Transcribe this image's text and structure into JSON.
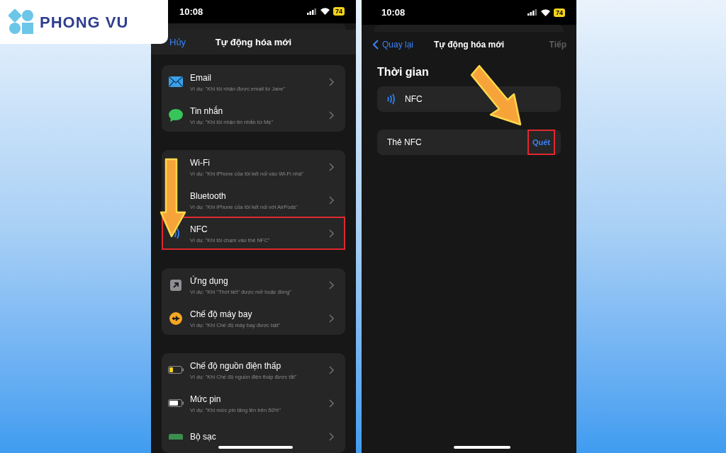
{
  "brand": {
    "name": "PHONG VU"
  },
  "screens": [
    {
      "kind": "trigger_list",
      "status_bar": {
        "time": "10:08",
        "battery": "74"
      },
      "nav": {
        "left": "Hủy",
        "title": "Tự động hóa mới"
      },
      "groups": [
        [
          {
            "title": "Email",
            "subtitle": "Ví dụ: \"Khi tôi nhận được email từ Jane\"",
            "highlighted": false
          },
          {
            "title": "Tin nhắn",
            "subtitle": "Ví dụ: \"Khi tôi nhận tin nhắn từ Mẹ\"",
            "highlighted": false
          }
        ],
        [
          {
            "title": "Wi-Fi",
            "subtitle": "Ví dụ: \"Khi iPhone của tôi kết nối vào Wi-Fi nhà\"",
            "highlighted": false
          },
          {
            "title": "Bluetooth",
            "subtitle": "Ví dụ: \"Khi iPhone của tôi kết nối với AirPods\"",
            "highlighted": false
          },
          {
            "title": "NFC",
            "subtitle": "Ví dụ: \"Khi tôi chạm vào thẻ NFC\"",
            "highlighted": true
          }
        ],
        [
          {
            "title": "Ứng dụng",
            "subtitle": "Ví dụ: \"Khi \"Thời tiết\" được mở hoặc đóng\"",
            "highlighted": false
          },
          {
            "title": "Chế độ máy bay",
            "subtitle": "Ví dụ: \"Khi Chế độ máy bay được bật\"",
            "highlighted": false
          }
        ],
        [
          {
            "title": "Chế độ nguồn điện thấp",
            "subtitle": "Ví dụ: \"Khi Chế độ nguồn điện thấp được tắt\"",
            "highlighted": false
          },
          {
            "title": "Mức pin",
            "subtitle": "Ví dụ: \"Khi mức pin tăng lên trên 50%\"",
            "highlighted": false
          },
          {
            "title": "Bộ sạc",
            "highlighted": false
          }
        ]
      ]
    },
    {
      "kind": "nfc_setup",
      "status_bar": {
        "time": "10:08",
        "battery": "74"
      },
      "nav": {
        "back": "Quay lại",
        "title": "Tự động hóa mới",
        "next": "Tiếp",
        "next_disabled": true
      },
      "header": "Thời gian",
      "trigger": {
        "label": "NFC"
      },
      "tag_row": {
        "label": "Thẻ NFC",
        "action": "Quét",
        "highlighted": true
      }
    }
  ]
}
